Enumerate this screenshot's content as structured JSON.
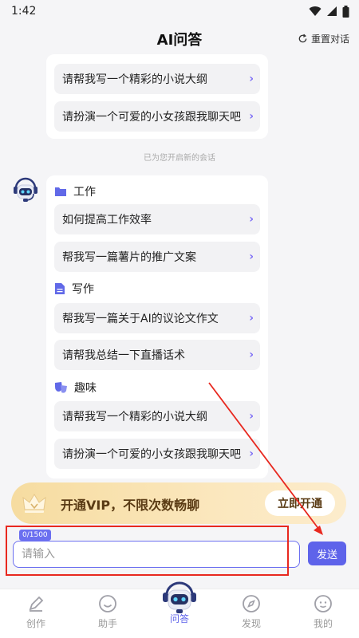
{
  "status": {
    "time": "1:42"
  },
  "header": {
    "title": "AI问答",
    "reset_label": "重置对话"
  },
  "top_card": {
    "items": [
      {
        "label": "请帮我写一个精彩的小说大纲"
      },
      {
        "label": "请扮演一个可爱的小女孩跟我聊天吧"
      }
    ]
  },
  "system_note": "已为您开启新的会话",
  "suggest_card": {
    "sections": [
      {
        "title": "工作",
        "icon": "folder-icon",
        "items": [
          {
            "label": "如何提高工作效率"
          },
          {
            "label": "帮我写一篇薯片的推广文案"
          }
        ]
      },
      {
        "title": "写作",
        "icon": "document-icon",
        "items": [
          {
            "label": "帮我写一篇关于AI的议论文作文"
          },
          {
            "label": "请帮我总结一下直播话术"
          }
        ]
      },
      {
        "title": "趣味",
        "icon": "masks-icon",
        "items": [
          {
            "label": "请帮我写一个精彩的小说大纲"
          },
          {
            "label": "请扮演一个可爱的小女孩跟我聊天吧"
          }
        ]
      }
    ]
  },
  "vip": {
    "text": "开通VIP，不限次数畅聊",
    "button": "立即开通"
  },
  "input": {
    "counter": "0/1500",
    "placeholder": "请输入",
    "value": ""
  },
  "send_label": "发送",
  "tabs": [
    {
      "label": "创作",
      "icon": "pen-icon",
      "active": false
    },
    {
      "label": "助手",
      "icon": "smile-icon",
      "active": false
    },
    {
      "label": "问答",
      "icon": "robot-icon",
      "active": true
    },
    {
      "label": "发现",
      "icon": "compass-icon",
      "active": false
    },
    {
      "label": "我的",
      "icon": "profile-icon",
      "active": false
    }
  ],
  "colors": {
    "accent": "#5e63ea",
    "chevron": "#7b6cf6",
    "vip_gold": "#f6dca0",
    "annotation_red": "#e8281f"
  }
}
